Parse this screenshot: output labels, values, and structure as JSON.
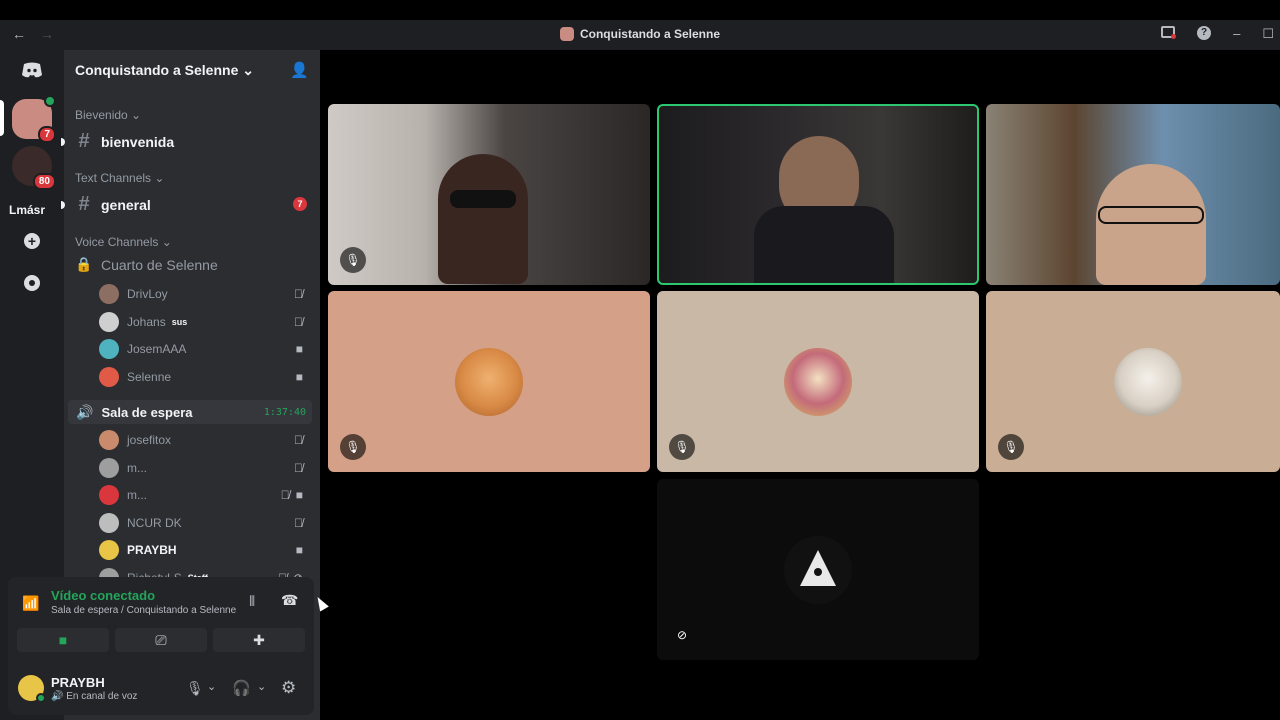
{
  "window": {
    "title": "Conquistando a Selenne",
    "nav_back": "←",
    "nav_forward": "→"
  },
  "guilds": {
    "items": [
      {
        "name": "discord-home",
        "glyph": "◉"
      },
      {
        "name": "server-1",
        "badge": "7"
      },
      {
        "name": "server-2",
        "badge": "80"
      },
      {
        "name": "server-lmasr",
        "label": "Lmásr"
      },
      {
        "name": "add-server",
        "glyph": "+"
      },
      {
        "name": "explore",
        "glyph": "⊘"
      }
    ]
  },
  "server": {
    "name": "Conquistando a Selenne",
    "chevron": "⌄"
  },
  "categories": {
    "welcome": "Bievenido",
    "text": "Text Channels",
    "voice": "Voice Channels"
  },
  "channels": {
    "bienvenida": "bienvenida",
    "general": "general",
    "general_badge": "7",
    "voice_locked": "Cuarto de Selenne",
    "voice_active": "Sala de espera",
    "voice_timer": "1:37:40"
  },
  "locked_members": [
    {
      "name": "DrivLoy",
      "color": "#8d6e63",
      "icons": [
        "mic-off"
      ]
    },
    {
      "name": "Johans",
      "tag": "sus",
      "color": "#cfcfcf",
      "icons": [
        "mic-off"
      ]
    },
    {
      "name": "JosemAAA",
      "color": "#4fb3bf",
      "icons": [
        "video"
      ]
    },
    {
      "name": "Selenne",
      "color": "#e05a47",
      "icons": [
        "video"
      ]
    }
  ],
  "active_members": [
    {
      "name": "josefitox",
      "color": "#c98b6b",
      "icons": [
        "mic-off"
      ]
    },
    {
      "name": "m...",
      "color": "#9e9e9e",
      "icons": [
        "mic-off"
      ]
    },
    {
      "name": "m...",
      "color": "#da373c",
      "icons": [
        "mic-off",
        "video"
      ]
    },
    {
      "name": "NCUR DK",
      "color": "#bdbdbd",
      "icons": [
        "mic-off"
      ]
    },
    {
      "name": "PRAYBH",
      "color": "#e8c547",
      "icons": [
        "video"
      ],
      "bold": true
    },
    {
      "name": "RichetyLS",
      "tag": "Staff",
      "color": "#9e9e9e",
      "icons": [
        "mic-off",
        "video-off"
      ]
    }
  ],
  "rtc": {
    "status": "Vídeo conectado",
    "location": "Sala de espera / Conquistando a Selenne",
    "camera_icon": "■",
    "screen_icon": "⎚",
    "activity_icon": "✚"
  },
  "user": {
    "name": "PRAYBH",
    "status": "En canal de voz"
  },
  "colors": {
    "accent_green": "#23a55a",
    "speaking_border": "#2dc770",
    "tile_peach": "#d4a088",
    "tile_beige": "#c9b8a6",
    "tile_tan": "#c9ad95"
  },
  "tiles": [
    {
      "name": "video-tile-1",
      "type": "video",
      "muted": true
    },
    {
      "name": "video-tile-2",
      "type": "video",
      "speaking": true
    },
    {
      "name": "video-tile-3",
      "type": "video"
    },
    {
      "name": "avatar-tile-cat",
      "type": "avatar",
      "muted": true
    },
    {
      "name": "avatar-tile-anime",
      "type": "avatar",
      "muted": true
    },
    {
      "name": "avatar-tile-dog",
      "type": "avatar",
      "muted": true
    },
    {
      "name": "avatar-tile-pyramid",
      "type": "avatar",
      "muted": true
    }
  ]
}
